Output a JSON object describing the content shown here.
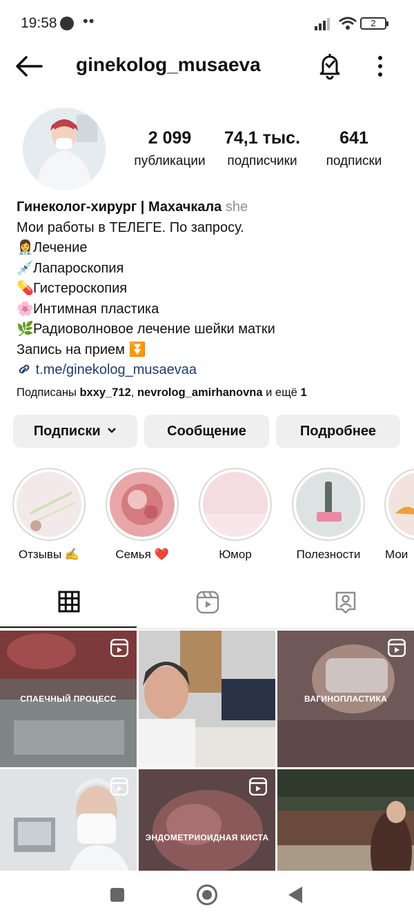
{
  "status_bar": {
    "time": "19:58",
    "dots": "••",
    "battery": "2"
  },
  "header": {
    "username": "ginekolog_musaeva"
  },
  "stats": [
    {
      "value": "2 099",
      "label": "публикации"
    },
    {
      "value": "74,1 тыс.",
      "label": "подписчики"
    },
    {
      "value": "641",
      "label": "подписки"
    }
  ],
  "bio": {
    "name": "Гинеколог-хирург | Махачкала",
    "pronoun": "she",
    "line1": "Мои работы в ТЕЛЕГЕ. По запросу.",
    "items": [
      {
        "emoji": "👩‍⚕️",
        "text": "Лечение"
      },
      {
        "emoji": "💉",
        "text": "Лапароскопия"
      },
      {
        "emoji": "💊",
        "text": "Гистероскопия"
      },
      {
        "emoji": "🌸",
        "text": "Интимная пластика"
      },
      {
        "emoji": "🌿",
        "text": "Радиоволновое лечение шейки матки"
      }
    ],
    "appointment": "Запись на прием",
    "appointment_emoji": "⏬",
    "link": "t.me/ginekolog_musaevaa"
  },
  "followed_by": {
    "prefix": "Подписаны",
    "user1": "bxxy_712",
    "sep": ",",
    "user2": "nevrolog_amirhanovna",
    "suffix": "и ещё",
    "count": "1"
  },
  "actions": {
    "following": "Подписки",
    "message": "Сообщение",
    "more": "Подробнее"
  },
  "highlights": [
    {
      "label": "Отзывы ✍️"
    },
    {
      "label": "Семья ❤️"
    },
    {
      "label": "Юмор"
    },
    {
      "label": "Полезности"
    },
    {
      "label": "Мои"
    }
  ],
  "grid": [
    {
      "caption": "СПАЕЧНЫЙ ПРОЦЕСС"
    },
    {
      "caption": ""
    },
    {
      "caption": "ВАГИНОПЛАСТИКА"
    },
    {
      "caption": ""
    },
    {
      "caption": "ЭНДОМЕТРИОИДНАЯ КИСТА"
    },
    {
      "caption": ""
    }
  ],
  "colors": {
    "link": "#1f3d73",
    "button_bg": "#efefef",
    "pronoun": "#8e8e8e"
  },
  "icons": [
    "back-arrow-icon",
    "bell-check-icon",
    "more-vertical-icon",
    "grid-icon",
    "reels-icon",
    "tagged-icon",
    "reel-badge-icon",
    "link-icon",
    "chevron-down-icon"
  ]
}
